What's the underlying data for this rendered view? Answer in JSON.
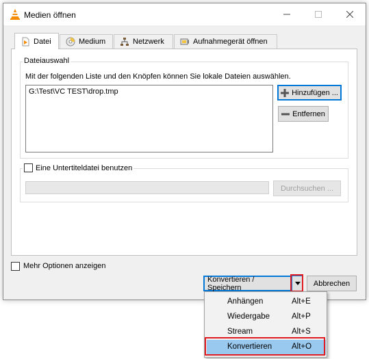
{
  "window": {
    "title": "Medien öffnen"
  },
  "tabs": [
    {
      "label": "Datei",
      "icon": "file-icon"
    },
    {
      "label": "Medium",
      "icon": "disc-icon"
    },
    {
      "label": "Netzwerk",
      "icon": "network-icon"
    },
    {
      "label": "Aufnahmegerät öffnen",
      "icon": "capture-device-icon"
    }
  ],
  "file_section": {
    "legend": "Dateiauswahl",
    "description": "Mit der folgenden Liste und den Knöpfen können Sie lokale Dateien auswählen.",
    "files": [
      "G:\\Test\\VC TEST\\drop.tmp"
    ],
    "add_button": "Hinzufügen ...",
    "remove_button": "Entfernen"
  },
  "subtitle_section": {
    "checkbox_label": "Eine Untertiteldatei benutzen",
    "browse_button": "Durchsuchen ..."
  },
  "more_options_label": "Mehr Optionen anzeigen",
  "footer": {
    "convert_button": "Konvertieren / Speichern",
    "cancel_button": "Abbrechen"
  },
  "dropdown_menu": [
    {
      "label": "Anhängen",
      "shortcut": "Alt+E"
    },
    {
      "label": "Wiedergabe",
      "shortcut": "Alt+P"
    },
    {
      "label": "Stream",
      "shortcut": "Alt+S"
    },
    {
      "label": "Konvertieren",
      "shortcut": "Alt+O"
    }
  ],
  "colors": {
    "accent": "#0078d7",
    "highlight": "#e11b22",
    "menu_selected": "#99c9ef",
    "vlc_orange": "#f48b00"
  }
}
